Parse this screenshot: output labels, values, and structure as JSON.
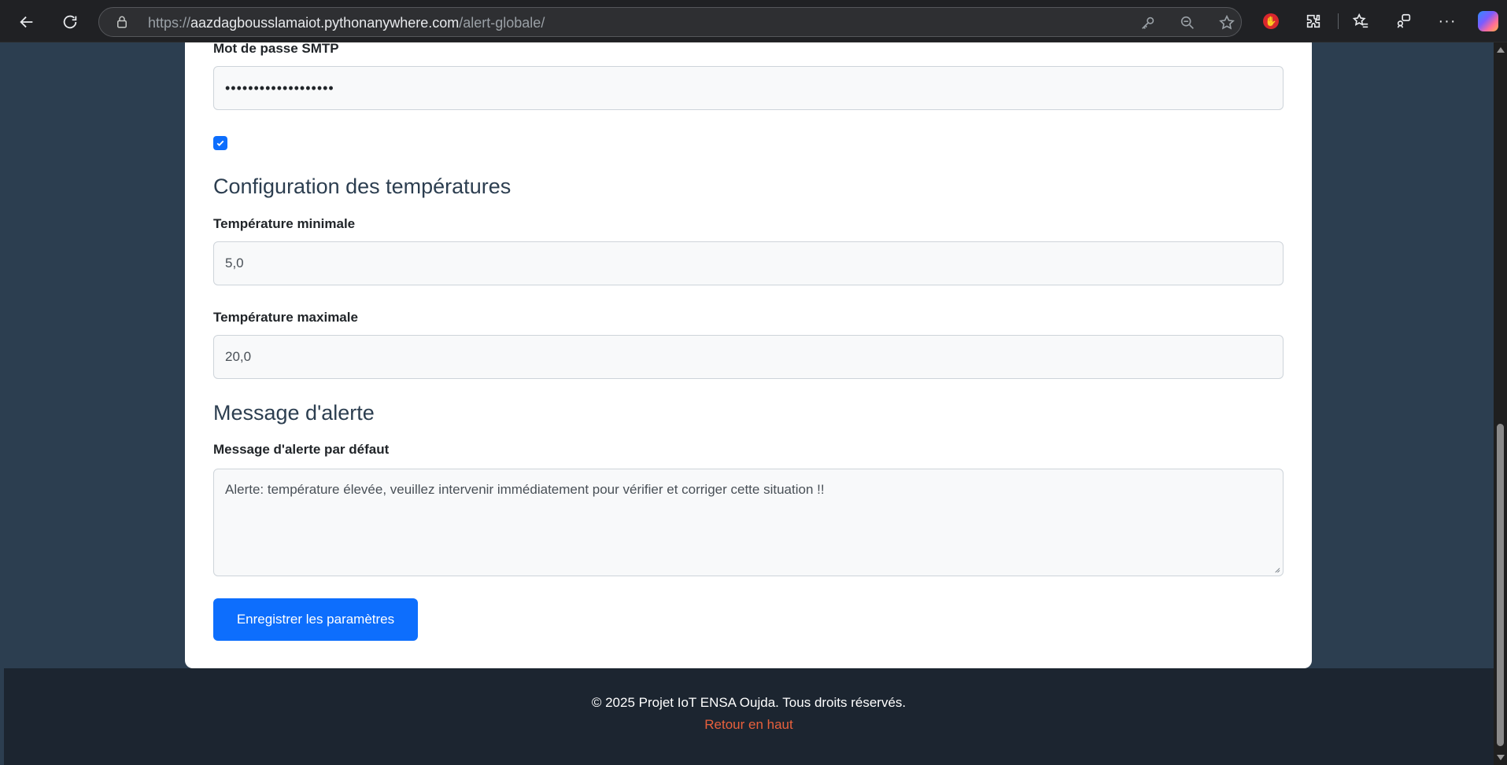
{
  "browser": {
    "url_prefix": "https://",
    "url_host": "aazdagbousslamaiot.pythonanywhere.com",
    "url_path": "/alert-globale/"
  },
  "form": {
    "smtp_password_label": "Mot de passe SMTP",
    "smtp_password_value": "•••••••••••••••••••",
    "checkbox_checked": true,
    "temp_section_title": "Configuration des températures",
    "temp_min_label": "Température minimale",
    "temp_min_value": "5,0",
    "temp_max_label": "Température maximale",
    "temp_max_value": "20,0",
    "alert_section_title": "Message d'alerte",
    "alert_message_label": "Message d'alerte par défaut",
    "alert_message_value": "Alerte: température élevée, veuillez intervenir immédiatement pour vérifier et corriger cette situation !!",
    "save_button_label": "Enregistrer les paramètres"
  },
  "footer": {
    "copyright": "© 2025 Projet IoT ENSA Oujda. Tous droits réservés.",
    "back_to_top": "Retour en haut"
  },
  "colors": {
    "page_bg": "#2c3e50",
    "primary": "#0d6efd",
    "footer_bg": "#1c2530",
    "footer_link": "#e8603c"
  }
}
